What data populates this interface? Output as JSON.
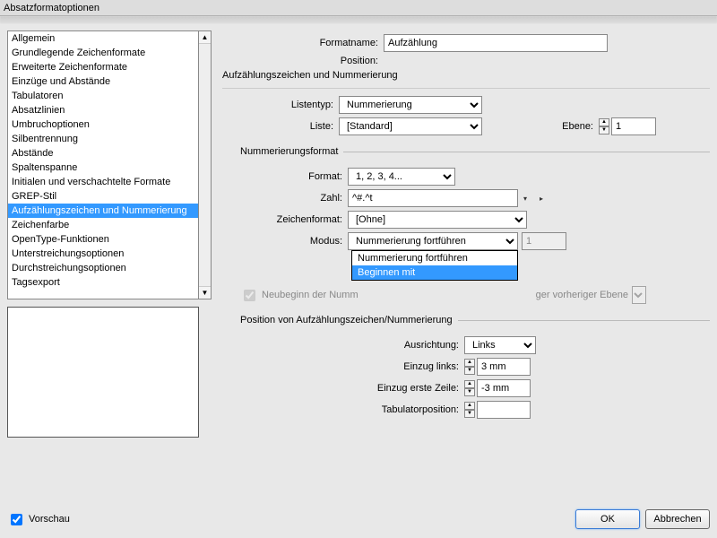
{
  "window": {
    "title": "Absatzformatoptionen"
  },
  "sidebar": {
    "items": [
      {
        "label": "Allgemein"
      },
      {
        "label": "Grundlegende Zeichenformate"
      },
      {
        "label": "Erweiterte Zeichenformate"
      },
      {
        "label": "Einzüge und Abstände"
      },
      {
        "label": "Tabulatoren"
      },
      {
        "label": "Absatzlinien"
      },
      {
        "label": "Umbruchoptionen"
      },
      {
        "label": "Silbentrennung"
      },
      {
        "label": "Abstände"
      },
      {
        "label": "Spaltenspanne"
      },
      {
        "label": "Initialen und verschachtelte Formate"
      },
      {
        "label": "GREP-Stil"
      },
      {
        "label": "Aufzählungszeichen und Nummerierung",
        "selected": true
      },
      {
        "label": "Zeichenfarbe"
      },
      {
        "label": "OpenType-Funktionen"
      },
      {
        "label": "Unterstreichungsoptionen"
      },
      {
        "label": "Durchstreichungsoptionen"
      },
      {
        "label": "Tagsexport"
      }
    ]
  },
  "header": {
    "formatname_label": "Formatname:",
    "formatname_value": "Aufzählung",
    "position_label": "Position:",
    "section_title": "Aufzählungszeichen und Nummerierung"
  },
  "list_section": {
    "listentyp_label": "Listentyp:",
    "listentyp_value": "Nummerierung",
    "liste_label": "Liste:",
    "liste_value": "[Standard]",
    "ebene_label": "Ebene:",
    "ebene_value": "1"
  },
  "nummerierungsformat": {
    "legend": "Nummerierungsformat",
    "format_label": "Format:",
    "format_value": "1, 2, 3, 4...",
    "zahl_label": "Zahl:",
    "zahl_value": "^#.^t",
    "zeichenformat_label": "Zeichenformat:",
    "zeichenformat_value": "[Ohne]",
    "modus_label": "Modus:",
    "modus_value": "Nummerierung fortführen",
    "modus_number": "1",
    "modus_options": [
      "Nummerierung fortführen",
      "Beginnen mit"
    ],
    "modus_hover_index": 1,
    "neubeginn_label_left": "Neubeginn der Numm",
    "neubeginn_label_right": "ger vorheriger Ebene"
  },
  "position_section": {
    "legend": "Position von Aufzählungszeichen/Nummerierung",
    "ausrichtung_label": "Ausrichtung:",
    "ausrichtung_value": "Links",
    "einzug_links_label": "Einzug links:",
    "einzug_links_value": "3 mm",
    "einzug_erste_label": "Einzug erste Zeile:",
    "einzug_erste_value": "-3 mm",
    "tabulator_label": "Tabulatorposition:",
    "tabulator_value": ""
  },
  "footer": {
    "vorschau_label": "Vorschau",
    "vorschau_checked": true,
    "ok": "OK",
    "cancel": "Abbrechen"
  }
}
